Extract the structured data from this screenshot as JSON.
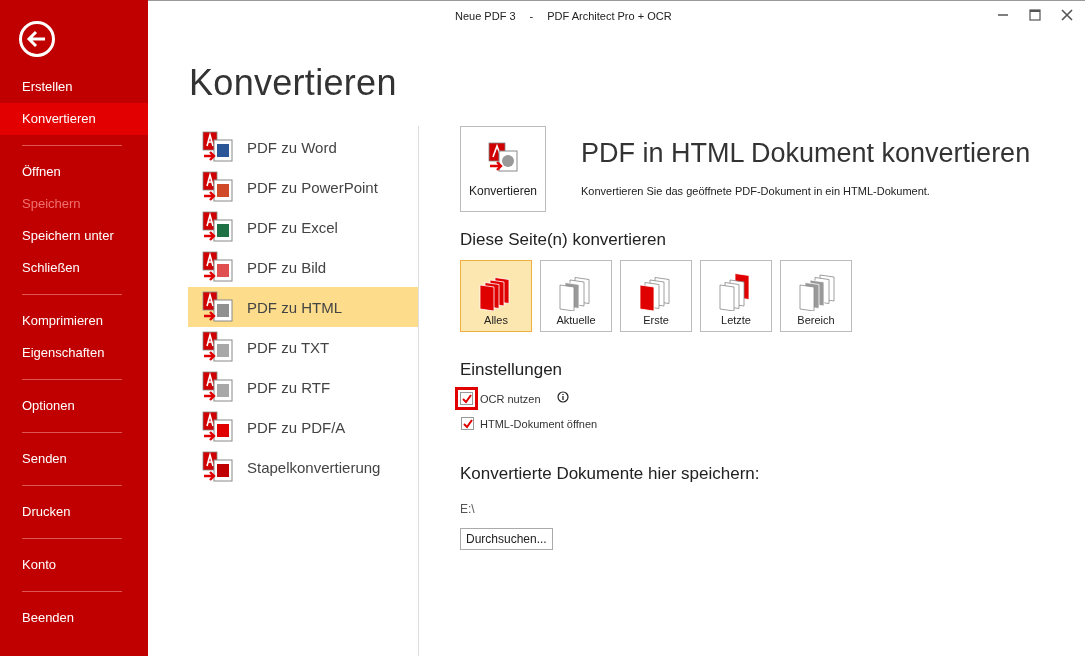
{
  "window": {
    "title": "Neue PDF 3",
    "separator": "-",
    "app": "PDF Architect Pro + OCR"
  },
  "sidebar": {
    "groups": [
      [
        {
          "label": "Erstellen",
          "selected": false,
          "disabled": false
        },
        {
          "label": "Konvertieren",
          "selected": true,
          "disabled": false
        }
      ],
      [
        {
          "label": "Öffnen",
          "selected": false,
          "disabled": false
        },
        {
          "label": "Speichern",
          "selected": false,
          "disabled": true
        },
        {
          "label": "Speichern unter",
          "selected": false,
          "disabled": false
        },
        {
          "label": "Schließen",
          "selected": false,
          "disabled": false
        }
      ],
      [
        {
          "label": "Komprimieren",
          "selected": false,
          "disabled": false
        },
        {
          "label": "Eigenschaften",
          "selected": false,
          "disabled": false
        }
      ],
      [
        {
          "label": "Optionen",
          "selected": false,
          "disabled": false
        }
      ],
      [
        {
          "label": "Senden",
          "selected": false,
          "disabled": false
        }
      ],
      [
        {
          "label": "Drucken",
          "selected": false,
          "disabled": false
        }
      ],
      [
        {
          "label": "Konto",
          "selected": false,
          "disabled": false
        }
      ],
      [
        {
          "label": "Beenden",
          "selected": false,
          "disabled": false
        }
      ]
    ]
  },
  "page_title": "Konvertieren",
  "conversions": [
    {
      "label": "PDF zu Word",
      "selected": false,
      "color": "#2b5797"
    },
    {
      "label": "PDF zu PowerPoint",
      "selected": false,
      "color": "#d04a2a"
    },
    {
      "label": "PDF zu Excel",
      "selected": false,
      "color": "#1e7145"
    },
    {
      "label": "PDF zu Bild",
      "selected": false,
      "color": "#e05050"
    },
    {
      "label": "PDF zu HTML",
      "selected": true,
      "color": "#909090"
    },
    {
      "label": "PDF zu TXT",
      "selected": false,
      "color": "#a8a8a8"
    },
    {
      "label": "PDF zu RTF",
      "selected": false,
      "color": "#a8a8a8"
    },
    {
      "label": "PDF zu PDF/A",
      "selected": false,
      "color": "#e00000"
    },
    {
      "label": "Stapelkonvertierung",
      "selected": false,
      "color": "#c00000"
    }
  ],
  "detail": {
    "button": "Konvertieren",
    "title": "PDF in HTML Dokument konvertieren",
    "description": "Konvertieren Sie das geöffnete PDF-Dokument in ein HTML-Dokument."
  },
  "pages": {
    "heading": "Diese Seite(n) konvertieren",
    "options": [
      {
        "label": "Alles",
        "kind": "all",
        "selected": true
      },
      {
        "label": "Aktuelle",
        "kind": "current",
        "selected": false
      },
      {
        "label": "Erste",
        "kind": "first",
        "selected": false
      },
      {
        "label": "Letzte",
        "kind": "last",
        "selected": false
      },
      {
        "label": "Bereich",
        "kind": "range",
        "selected": false
      }
    ]
  },
  "settings": {
    "heading": "Einstellungen",
    "options": [
      {
        "label": "OCR nutzen",
        "checked": true,
        "highlighted": true,
        "info": true
      },
      {
        "label": "HTML-Dokument öffnen",
        "checked": true,
        "highlighted": false,
        "info": false
      }
    ]
  },
  "save": {
    "heading": "Konvertierte Dokumente hier speichern:",
    "path": "E:\\",
    "button": "Durchsuchen..."
  }
}
